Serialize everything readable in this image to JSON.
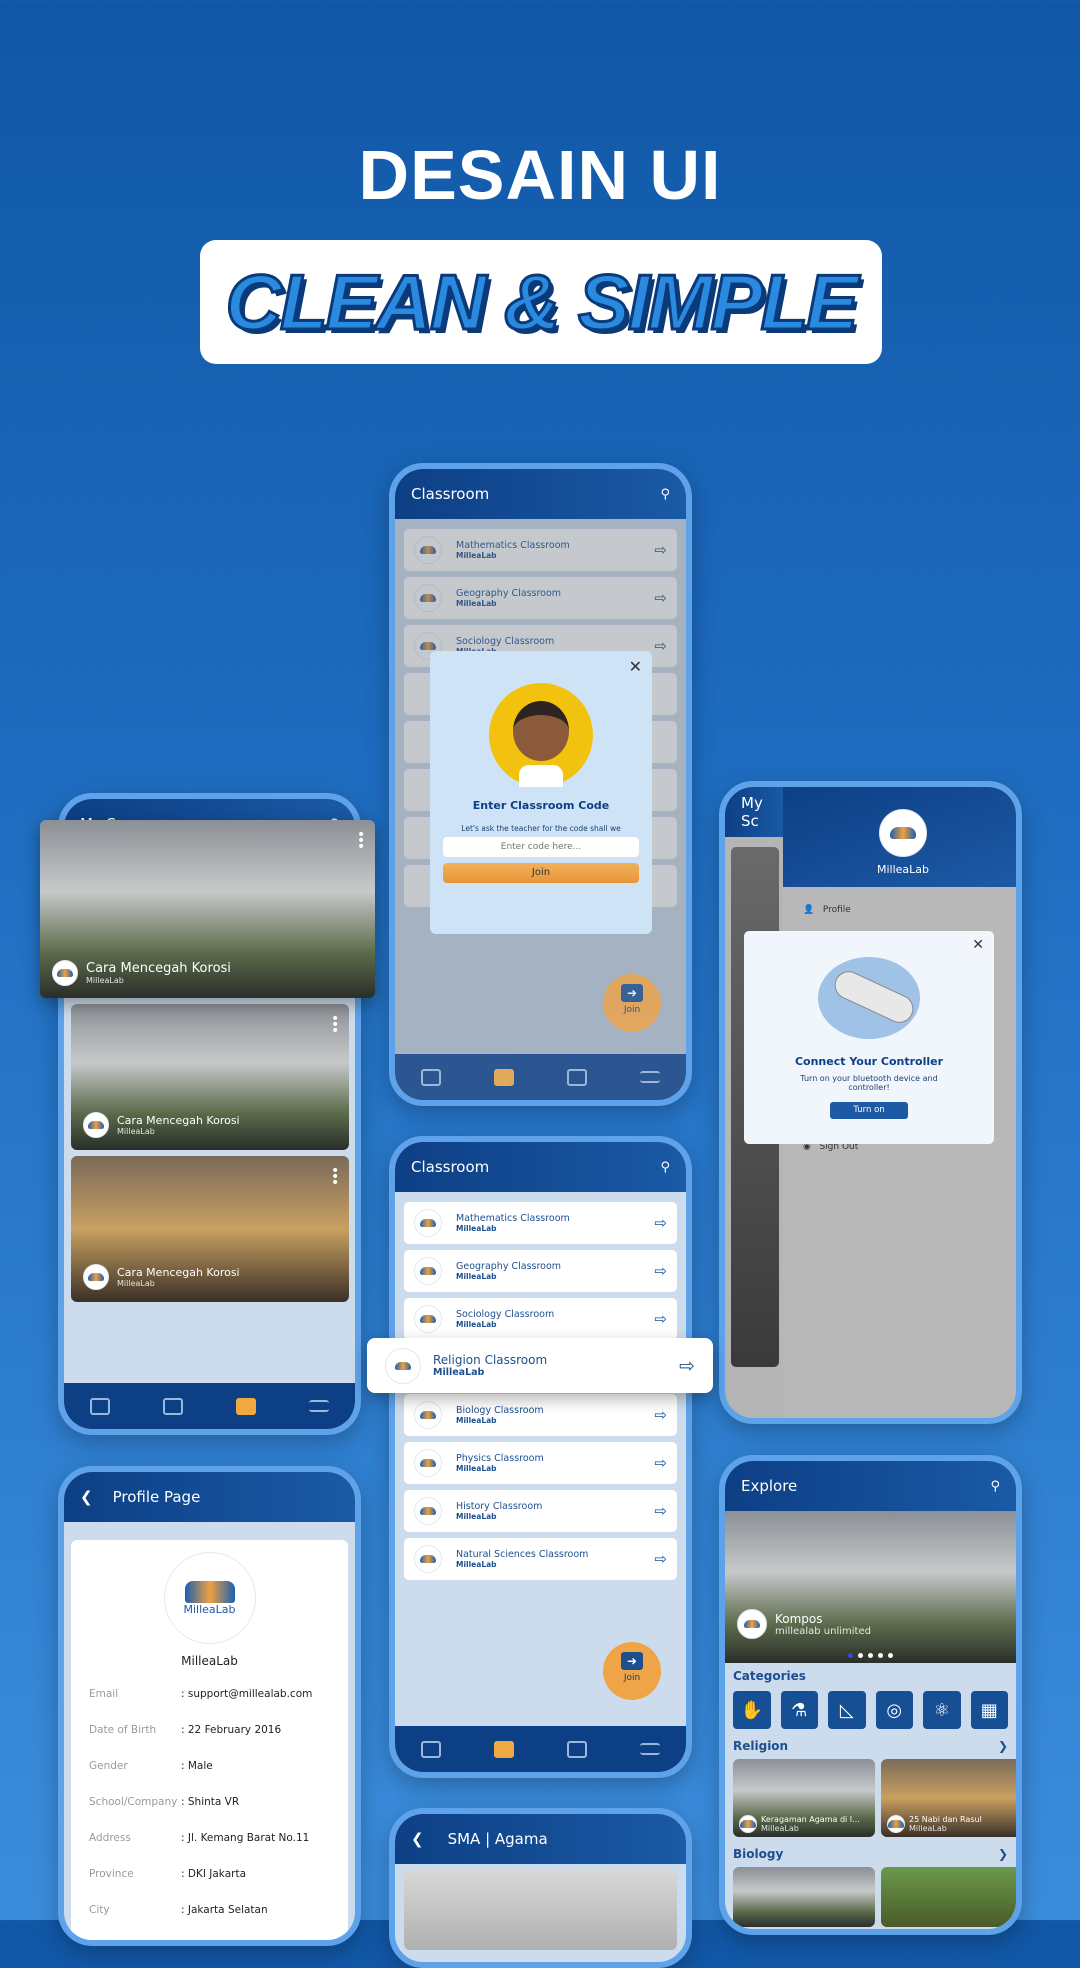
{
  "headline": "DESAIN UI",
  "badge": "CLEAN & SIMPLE",
  "brand": "MilleaLab",
  "classroom_modal_screen": {
    "title": "Classroom",
    "rows": [
      {
        "name": "Mathematics Classroom",
        "owner": "MilleaLab"
      },
      {
        "name": "Geography Classroom",
        "owner": "MilleaLab"
      },
      {
        "name": "Sociology Classroom",
        "owner": "MilleaLab"
      }
    ],
    "modal": {
      "title": "Enter Classroom Code",
      "subtitle": "Let's ask the teacher for the code shall we",
      "placeholder": "Enter code here...",
      "button": "Join"
    },
    "fab": "Join"
  },
  "my_scene_screen": {
    "title": "My Scene",
    "cards": [
      {
        "title": "Cara Mencegah Korosi",
        "owner": "MilleaLab"
      },
      {
        "title": "Cara Mencegah Korosi",
        "owner": "MilleaLab"
      },
      {
        "title": "Cara Mencegah Korosi",
        "owner": "MilleaLab"
      }
    ]
  },
  "drawer_screen": {
    "title": "My Sc",
    "user": "MilleaLab",
    "items": [
      "Profile",
      "Sign Out"
    ],
    "modal": {
      "title": "Connect Your Controller",
      "subtitle": "Turn on your bluetooth device and controller!",
      "button": "Turn on"
    }
  },
  "classroom_screen": {
    "title": "Classroom",
    "rows": [
      {
        "name": "Mathematics Classroom",
        "owner": "MilleaLab"
      },
      {
        "name": "Geography Classroom",
        "owner": "MilleaLab"
      },
      {
        "name": "Sociology Classroom",
        "owner": "MilleaLab"
      },
      {
        "name": "Religion Classroom",
        "owner": "MilleaLab"
      },
      {
        "name": "Biology Classroom",
        "owner": "MilleaLab"
      },
      {
        "name": "Physics Classroom",
        "owner": "MilleaLab"
      },
      {
        "name": "History Classroom",
        "owner": "MilleaLab"
      },
      {
        "name": "Natural Sciences Classroom",
        "owner": "MilleaLab"
      }
    ],
    "fab": "Join"
  },
  "profile_screen": {
    "title": "Profile Page",
    "name": "MilleaLab",
    "fields": [
      {
        "label": "Email",
        "value": ": support@millealab.com"
      },
      {
        "label": "Date of Birth",
        "value": ": 22 February 2016"
      },
      {
        "label": "Gender",
        "value": ": Male"
      },
      {
        "label": "School/Company",
        "value": ": Shinta VR"
      },
      {
        "label": "Address",
        "value": ": Jl. Kemang Barat No.11"
      },
      {
        "label": "Province",
        "value": ": DKI Jakarta"
      },
      {
        "label": "City",
        "value": ": Jakarta Selatan"
      }
    ]
  },
  "explore_screen": {
    "title": "Explore",
    "hero": {
      "title": "Kompos",
      "owner": "millealab unlimited",
      "slides": 5,
      "active_slide": 1
    },
    "categories_label": "Categories",
    "category_icons": [
      "hands-icon",
      "microscope-icon",
      "ruler-triangle-icon",
      "globe-icon",
      "atom-icon",
      "calculator-icon"
    ],
    "sections": [
      {
        "label": "Religion",
        "items": [
          {
            "title": "Keragaman Agama di I...",
            "owner": "MilleaLab"
          },
          {
            "title": "25 Nabi dan Rasul",
            "owner": "MilleaLab"
          }
        ]
      },
      {
        "label": "Biology",
        "items": []
      }
    ]
  },
  "sma_screen": {
    "title": "SMA | Agama"
  }
}
